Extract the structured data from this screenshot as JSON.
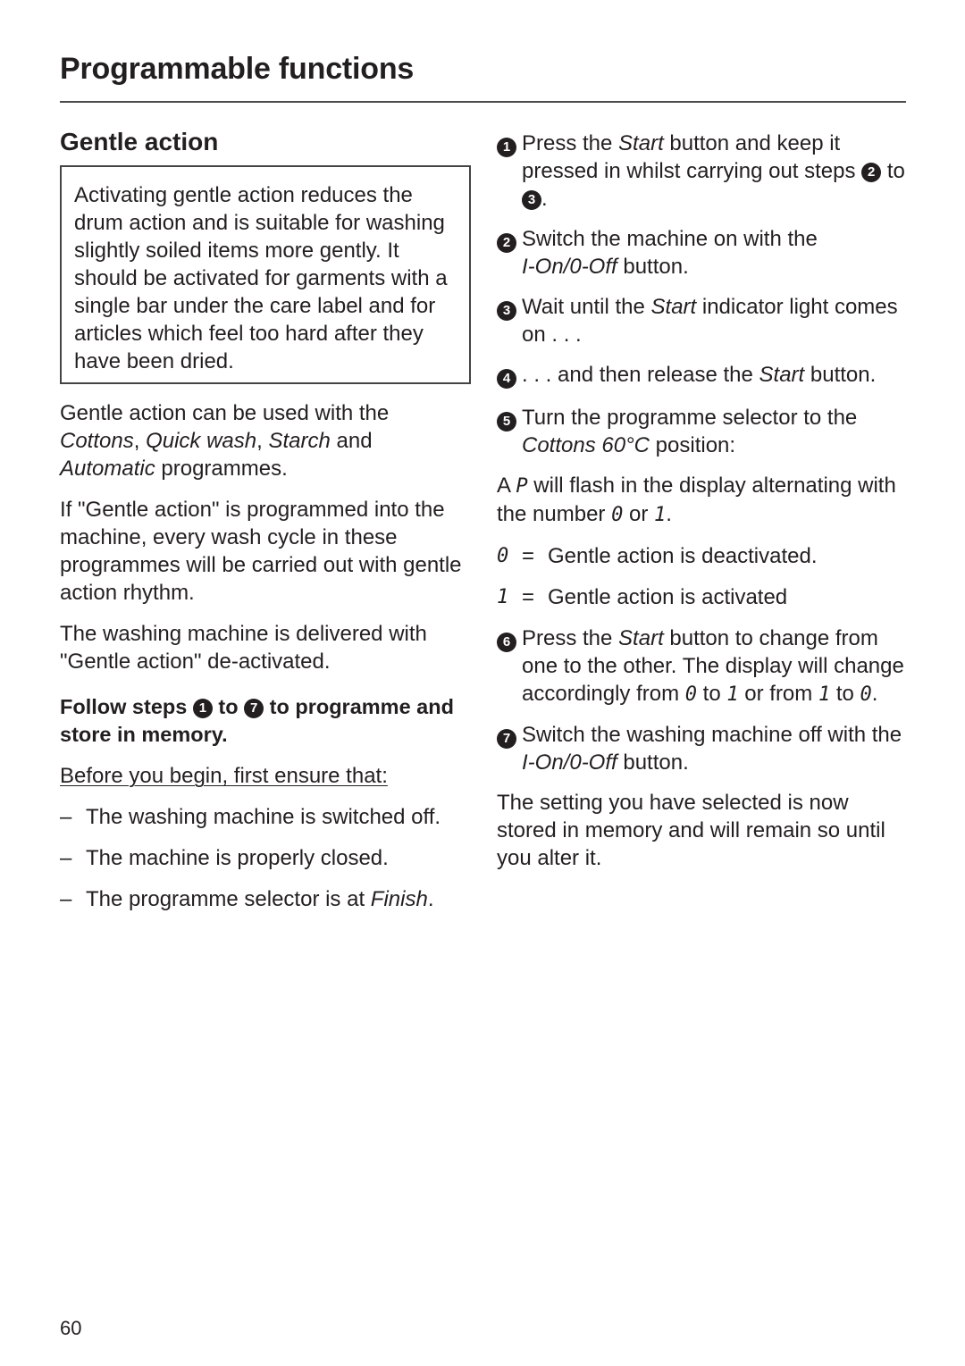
{
  "header": {
    "title": "Programmable functions"
  },
  "section": {
    "heading": "Gentle action",
    "info_box": "Activating gentle action reduces the drum action and is suitable for washing slightly soiled items more gently. It should be activated for garments with a single bar under the care label and for articles which feel too hard after they have been dried.",
    "usage_para": {
      "t1": "Gentle action can be used with the ",
      "p1": "Cottons",
      "t2": ", ",
      "p2": "Quick wash",
      "t3": ", ",
      "p3": "Starch",
      "t4": " and ",
      "p4": "Automatic",
      "t5": " programmes."
    },
    "programmed_para": "If \"Gentle action\" is programmed into the machine, every wash cycle in these programmes will be carried out with gentle action rhythm.",
    "delivered_para": "The washing machine is delivered with \"Gentle action\" de-activated.",
    "follow_steps": {
      "t1": "Follow steps ",
      "from_step": "1",
      "t2": " to ",
      "to_step": "7",
      "t3": " to programme and store in memory."
    },
    "before_begin": "Before you begin, first ensure that:",
    "checklist": [
      {
        "dash": "–",
        "text": "The washing machine is switched off."
      },
      {
        "dash": "–",
        "text": "The machine is properly closed."
      },
      {
        "dash": "–",
        "text_before": "The programme selector is at ",
        "italic": "Finish",
        "text_after": "."
      }
    ]
  },
  "steps": [
    {
      "num": "1",
      "t1": "Press the ",
      "i1": "Start",
      "t2": " button and keep it pressed in whilst carrying out steps ",
      "ref_a": "2",
      "t3": " to ",
      "ref_b": "3",
      "t4": "."
    },
    {
      "num": "2",
      "t1": "Switch the machine on with the ",
      "i1": "I-On/0-Off",
      "t2": " button."
    },
    {
      "num": "3",
      "t1": "Wait until the ",
      "i1": "Start",
      "t2": " indicator light comes on . . ."
    },
    {
      "num": "4",
      "t1": ". . . and then release the ",
      "i1": "Start",
      "t2": " button."
    },
    {
      "num": "5",
      "t1": "Turn the programme selector to the ",
      "i1": "Cottons 60°C",
      "t2": " position:"
    },
    {
      "num": "6",
      "t1": "Press the ",
      "i1": "Start",
      "t2": " button to change from one to the other. The display will change accordingly from ",
      "d1": "0",
      "t3": " to ",
      "d2": "1",
      "t4": " or from ",
      "d3": "1",
      "t5": " to ",
      "d4": "0",
      "t6": "."
    },
    {
      "num": "7",
      "t1": "Switch the washing machine off with the ",
      "i1": "I-On/0-Off",
      "t2": " button."
    }
  ],
  "display_para": {
    "t1": "A ",
    "p_symbol": "P",
    "t2": " will flash in the display alternating with the number ",
    "zero": "0",
    "t3": " or ",
    "one": "1",
    "t4": "."
  },
  "legend": [
    {
      "key": "0",
      "eq": "=",
      "text": "Gentle action is deactivated."
    },
    {
      "key": "1",
      "eq": "=",
      "text": "Gentle action is activated"
    }
  ],
  "closing_para": "The setting you have selected is now stored in memory and will remain so until you alter it.",
  "footer": {
    "page_number": "60"
  }
}
